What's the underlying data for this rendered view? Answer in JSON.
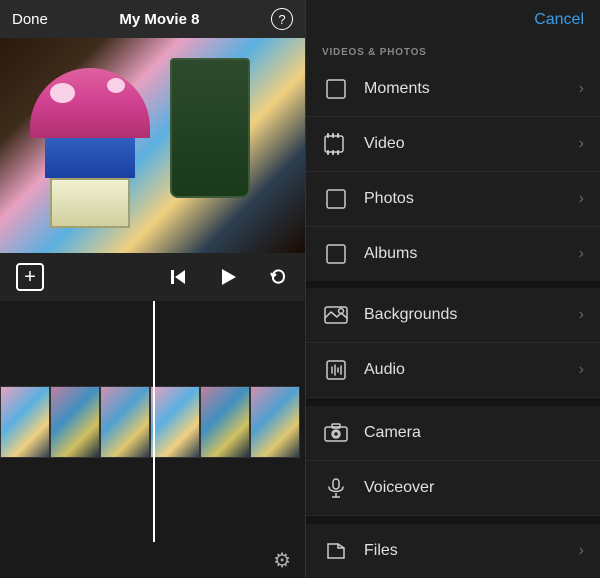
{
  "header": {
    "done_label": "Done",
    "title": "My Movie 8",
    "help_label": "?"
  },
  "controls": {
    "add_label": "+",
    "skip_back_label": "⏮",
    "play_label": "▶",
    "undo_label": "↩"
  },
  "bottom": {
    "settings_label": "⚙"
  },
  "right_panel": {
    "cancel_label": "Cancel",
    "section_label": "VIDEOS & PHOTOS",
    "menu_items": [
      {
        "id": "moments",
        "label": "Moments",
        "icon": "square"
      },
      {
        "id": "video",
        "label": "Video",
        "icon": "film"
      },
      {
        "id": "photos",
        "label": "Photos",
        "icon": "square"
      },
      {
        "id": "albums",
        "label": "Albums",
        "icon": "square"
      }
    ],
    "other_items": [
      {
        "id": "backgrounds",
        "label": "Backgrounds",
        "icon": "image"
      },
      {
        "id": "audio",
        "label": "Audio",
        "icon": "music"
      },
      {
        "id": "camera",
        "label": "Camera",
        "icon": "camera"
      },
      {
        "id": "voiceover",
        "label": "Voiceover",
        "icon": "mic"
      },
      {
        "id": "files",
        "label": "Files",
        "icon": "folder"
      }
    ]
  }
}
